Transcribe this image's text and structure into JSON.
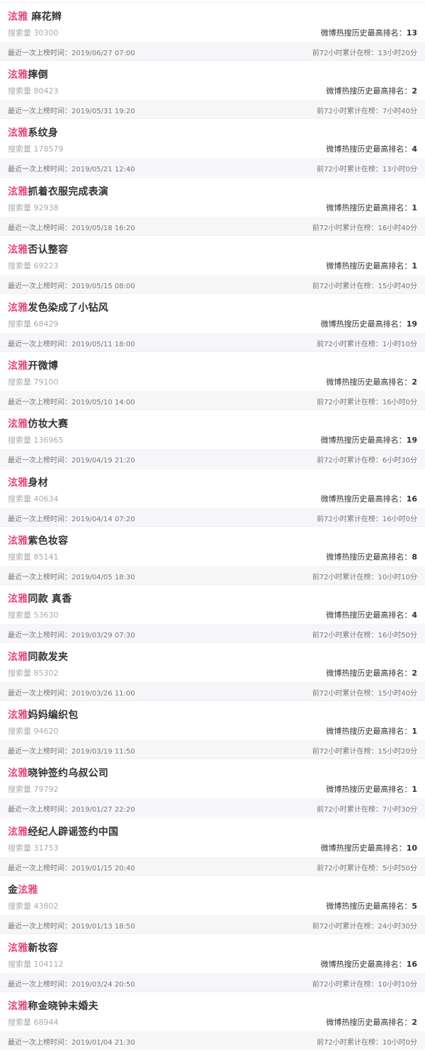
{
  "labels": {
    "count_prefix": "搜索量 ",
    "rank_prefix": "微博热搜历史最高排名：",
    "last_prefix": "最近一次上榜时间：",
    "duration_prefix": "前72小时累计在榜："
  },
  "items": [
    {
      "pre": "",
      "hl": "泫雅",
      "post": " 麻花辫",
      "count": "30300",
      "rank": "13",
      "last": "2019/06/27 07:00",
      "duration": "13小时20分"
    },
    {
      "pre": "",
      "hl": "泫雅",
      "post": "摔倒",
      "count": "80423",
      "rank": "2",
      "last": "2019/05/31 19:20",
      "duration": "7小时40分"
    },
    {
      "pre": "",
      "hl": "泫雅",
      "post": "系纹身",
      "count": "178579",
      "rank": "4",
      "last": "2019/05/21 12:40",
      "duration": "13小时0分"
    },
    {
      "pre": "",
      "hl": "泫雅",
      "post": "抓着衣服完成表演",
      "count": "92938",
      "rank": "1",
      "last": "2019/05/18 16:20",
      "duration": "16小时40分"
    },
    {
      "pre": "",
      "hl": "泫雅",
      "post": "否认整容",
      "count": "69223",
      "rank": "1",
      "last": "2019/05/15 08:00",
      "duration": "15小时40分"
    },
    {
      "pre": "",
      "hl": "泫雅",
      "post": "发色染成了小钻风",
      "count": "68429",
      "rank": "19",
      "last": "2019/05/11 18:00",
      "duration": "1小时10分"
    },
    {
      "pre": "",
      "hl": "泫雅",
      "post": "开微博",
      "count": "79100",
      "rank": "2",
      "last": "2019/05/10 14:00",
      "duration": "16小时0分"
    },
    {
      "pre": "",
      "hl": "泫雅",
      "post": "仿妆大赛",
      "count": "136965",
      "rank": "19",
      "last": "2019/04/19 21:20",
      "duration": "6小时30分"
    },
    {
      "pre": "",
      "hl": "泫雅",
      "post": "身材",
      "count": "40634",
      "rank": "16",
      "last": "2019/04/14 07:20",
      "duration": "16小时0分"
    },
    {
      "pre": "",
      "hl": "泫雅",
      "post": "紫色妆容",
      "count": "85141",
      "rank": "8",
      "last": "2019/04/05 18:30",
      "duration": "10小时10分"
    },
    {
      "pre": "",
      "hl": "泫雅",
      "post": "同款 真香",
      "count": "53630",
      "rank": "4",
      "last": "2019/03/29 07:30",
      "duration": "16小时50分"
    },
    {
      "pre": "",
      "hl": "泫雅",
      "post": "同款发夹",
      "count": "85302",
      "rank": "2",
      "last": "2019/03/26 11:00",
      "duration": "15小时40分"
    },
    {
      "pre": "",
      "hl": "泫雅",
      "post": "妈妈编织包",
      "count": "94620",
      "rank": "1",
      "last": "2019/03/19 11:50",
      "duration": "15小时20分"
    },
    {
      "pre": "",
      "hl": "泫雅",
      "post": "晓钟签约乌叔公司",
      "count": "79792",
      "rank": "1",
      "last": "2019/01/27 22:20",
      "duration": "7小时30分"
    },
    {
      "pre": "",
      "hl": "泫雅",
      "post": "经纪人辟谣签约中国",
      "count": "31753",
      "rank": "10",
      "last": "2019/01/15 20:40",
      "duration": "5小时50分"
    },
    {
      "pre": "金",
      "hl": "泫雅",
      "post": "",
      "count": "43802",
      "rank": "5",
      "last": "2019/01/13 18:50",
      "duration": "24小时30分"
    },
    {
      "pre": "",
      "hl": "泫雅",
      "post": "新妆容",
      "count": "104112",
      "rank": "16",
      "last": "2019/03/24 20:50",
      "duration": "10小时10分"
    },
    {
      "pre": "",
      "hl": "泫雅",
      "post": "称金晓钟未婚夫",
      "count": "68944",
      "rank": "2",
      "last": "2019/01/04 21:30",
      "duration": "10小时0分"
    }
  ],
  "colors": {
    "highlight": "#e8467c",
    "footer_bg": "#f6f6f9"
  }
}
